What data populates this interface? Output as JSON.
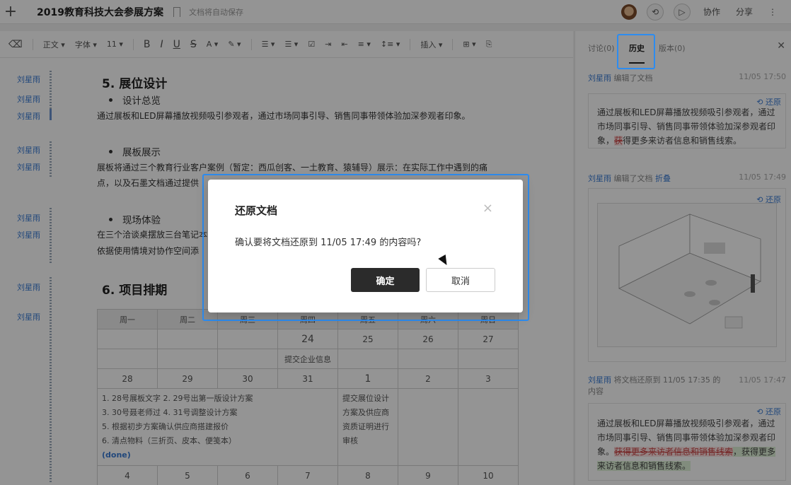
{
  "topbar": {
    "plus": "+",
    "title": "2019教育科技大会参展方案",
    "autosave": "文档将自动保存",
    "collab": "协作",
    "share": "分享",
    "more": "⋮"
  },
  "toolbar": {
    "eraser": "⌫",
    "style": "正文 ▾",
    "font": "字体 ▾",
    "size": "11 ▾",
    "bold": "B",
    "italic": "I",
    "underline": "U",
    "strike": "S",
    "fontcolor": "A ▾",
    "highlight": "✎ ▾",
    "olist": "☰ ▾",
    "ulist": "☰ ▾",
    "check": "☑",
    "indent": "⇥",
    "outdent": "⇤",
    "align": "≡ ▾",
    "lineheight": "↕≡ ▾",
    "insert": "插入 ▾",
    "table": "⊞ ▾",
    "format": "⎘"
  },
  "gutter": {
    "authors": [
      "刘星雨",
      "刘星雨",
      "刘星雨",
      "刘星雨",
      "刘星雨",
      "刘星雨",
      "刘星雨",
      "刘星雨",
      "刘星雨"
    ]
  },
  "doc": {
    "h5": "5. 展位设计",
    "bullet1": "设计总览",
    "p1": "通过展板和LED屏幕播放视频吸引参观者，通过市场同事引导、销售同事带领体验加深参观者印象。",
    "bullet2": "展板展示",
    "p2a": "展板将通过三个教育行业客户案例（暂定：西瓜创客、一土教育、猿辅导）展示：在实际工作中遇到的痛",
    "p2b": "点，以及石墨文档通过提供",
    "bullet3": "现场体验",
    "p3a": "在三个洽谈桌摆放三台笔记本",
    "p3b": "依据使用情境对协作空间添",
    "h6": "6. 项目排期",
    "table": {
      "headers": [
        "周一",
        "周二",
        "周三",
        "周四",
        "周五",
        "周六",
        "周日"
      ],
      "row1": [
        "",
        "",
        "",
        "24",
        "25",
        "26",
        "27"
      ],
      "row1b": [
        "",
        "",
        "",
        "提交企业信息",
        "",
        "",
        ""
      ],
      "row2": [
        "28",
        "29",
        "30",
        "31",
        "1",
        "2",
        "3"
      ],
      "tasks": [
        "1. 28号展板文字  2. 29号出第一版设计方案",
        "3. 30号聂老师过  4. 31号调整设计方案",
        "5. 根据初步方案确认供应商搭建报价",
        "6. 清点物料（三折页、皮本、便笺本）"
      ],
      "done": "(done)",
      "task_fri": [
        "提交展位设计",
        "方案及供应商",
        "资质证明进行",
        "审核"
      ],
      "row3": [
        "4",
        "5",
        "6",
        "7",
        "8",
        "9",
        "10"
      ]
    }
  },
  "panel": {
    "tab_discuss": "讨论(0)",
    "tab_history": "历史",
    "tab_version": "版本(0)",
    "close": "✕",
    "ev1": {
      "who": "刘星雨",
      "action": " 编辑了文档",
      "time": "11/05 17:50"
    },
    "card1": {
      "restore": "⟲ 还原",
      "text": "通过展板和LED屏幕播放视频吸引参观者，通过市场同事引导、销售同事带领体验加深参观者印象，",
      "del": "获",
      "rest": "得更多来访者信息和销售线索。"
    },
    "ev2": {
      "who": "刘星雨",
      "action": " 编辑了文档 ",
      "fold": "折叠",
      "time": "11/05 17:49"
    },
    "card2": {
      "restore": "⟲ 还原"
    },
    "ev3": {
      "who": "刘星雨",
      "action": " 将文档还原到 11/05 17:35 的",
      "line2": "内容",
      "time": "11/05 17:47"
    },
    "card3": {
      "restore": "⟲ 还原",
      "text": "通过展板和LED屏幕播放视频吸引参观者，通过市场同事引导、销售同事带领体验加深参观者印象。",
      "del": "获得更多来访者信息和销售线索",
      "ins": "，获得更多来访者信息和销售线索。"
    }
  },
  "dialog": {
    "title": "还原文档",
    "close": "×",
    "message": "确认要将文档还原到 11/05 17:49 的内容吗?",
    "ok": "确定",
    "cancel": "取消"
  },
  "colors": {
    "accent": "#2d8cf0",
    "link": "#3a7bd5",
    "primary_btn": "#2b2b2b"
  }
}
